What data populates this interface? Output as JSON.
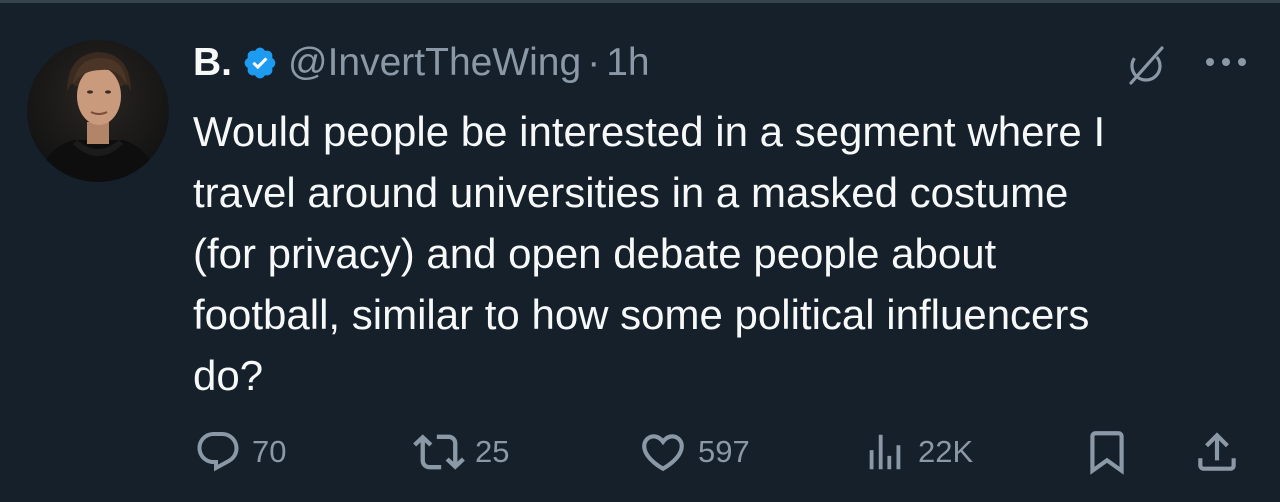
{
  "tweet": {
    "author_name": "B.",
    "handle": "@InvertTheWing",
    "separator": "·",
    "time": "1h",
    "text_lines": [
      "Would people be interested in a segment where I",
      "travel around universities in a masked costume",
      "(for privacy) and open debate people about",
      "football, similar to how some political influencers",
      "do?"
    ]
  },
  "actions": {
    "replies": "70",
    "reposts": "25",
    "likes": "597",
    "views": "22K"
  },
  "icons": {
    "avatar": "profile-photo",
    "verified": "verified-badge-icon",
    "grok": "grok-icon",
    "more": "more-options-icon",
    "reply": "reply-icon",
    "repost": "repost-icon",
    "like": "heart-icon",
    "views": "views-icon",
    "bookmark": "bookmark-icon",
    "share": "share-icon"
  },
  "colors": {
    "background": "#15202b",
    "text": "#f7f9f9",
    "secondary": "#8b98a5",
    "verified": "#1d9bf0"
  }
}
